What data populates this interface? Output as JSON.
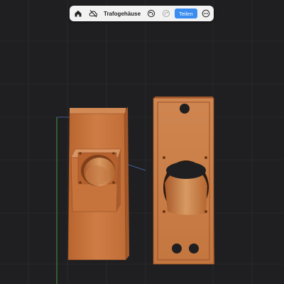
{
  "toolbar": {
    "title": "Trafogehäuse",
    "share_label": "Teilen",
    "icons": [
      "home-icon",
      "cloud-offline-icon",
      "undo-icon",
      "redo-icon",
      "more-icon"
    ]
  },
  "colors": {
    "background": "#1f1f21",
    "grid": "#2b2b2e",
    "model_orange": "#c8763f",
    "accent_blue": "#3b8cf0",
    "toolbar_bg": "#f2f2f2"
  }
}
